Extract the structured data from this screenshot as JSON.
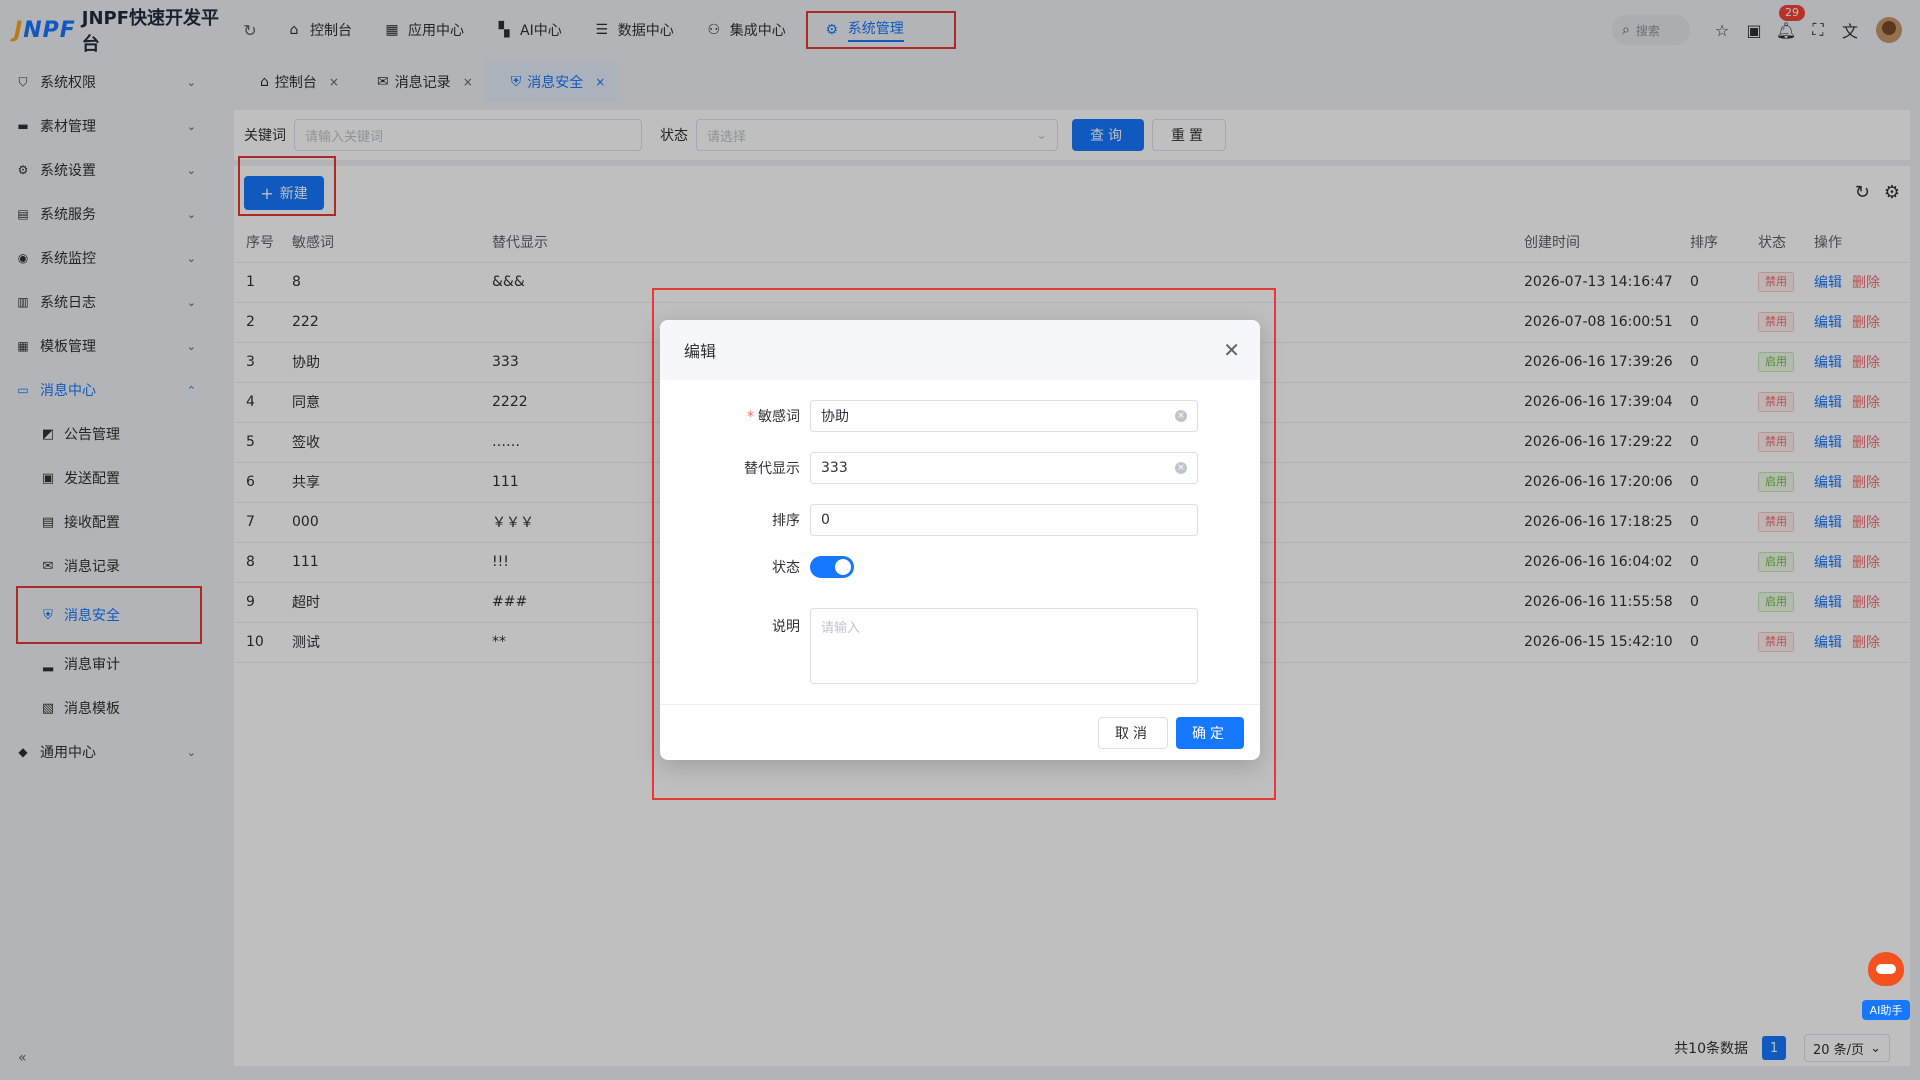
{
  "app": {
    "logo_mark_a": "J",
    "logo_mark_b": "N",
    "logo_mark_c": "PF",
    "title": "JNPF快速开发平台"
  },
  "topnav": [
    {
      "label": "控制台",
      "icon": "home-icon"
    },
    {
      "label": "应用中心",
      "icon": "grid-icon"
    },
    {
      "label": "AI中心",
      "icon": "ai-icon"
    },
    {
      "label": "数据中心",
      "icon": "database-icon"
    },
    {
      "label": "集成中心",
      "icon": "integration-icon"
    },
    {
      "label": "系统管理",
      "icon": "gear-icon",
      "active": true
    }
  ],
  "header_tools": {
    "search_placeholder": "搜索",
    "notification_count": "29"
  },
  "sidebar": {
    "items": [
      {
        "label": "系统权限"
      },
      {
        "label": "素材管理"
      },
      {
        "label": "系统设置"
      },
      {
        "label": "系统服务"
      },
      {
        "label": "系统监控"
      },
      {
        "label": "系统日志"
      },
      {
        "label": "模板管理"
      },
      {
        "label": "消息中心",
        "open": true
      },
      {
        "label": "通用中心"
      }
    ],
    "subitems": [
      {
        "label": "公告管理"
      },
      {
        "label": "发送配置"
      },
      {
        "label": "接收配置"
      },
      {
        "label": "消息记录"
      },
      {
        "label": "消息安全",
        "active": true
      },
      {
        "label": "消息审计"
      },
      {
        "label": "消息模板"
      }
    ]
  },
  "tabs": [
    {
      "label": "控制台"
    },
    {
      "label": "消息记录"
    },
    {
      "label": "消息安全",
      "active": true
    }
  ],
  "filter": {
    "keyword_label": "关键词",
    "keyword_placeholder": "请输入关键词",
    "status_label": "状态",
    "status_placeholder": "请选择",
    "query_label": "查询",
    "reset_label": "重置"
  },
  "toolbar": {
    "new_label": "新建"
  },
  "table": {
    "columns": [
      "序号",
      "敏感词",
      "替代显示",
      "创建时间",
      "排序",
      "状态",
      "操作"
    ],
    "rows": [
      {
        "no": "1",
        "word": "8",
        "replace": "&&&",
        "time": "2026-07-13 14:16:47",
        "sort": "0",
        "status": "禁用"
      },
      {
        "no": "2",
        "word": "222",
        "replace": "",
        "time": "2026-07-08 16:00:51",
        "sort": "0",
        "status": "禁用"
      },
      {
        "no": "3",
        "word": "协助",
        "replace": "333",
        "time": "2026-06-16 17:39:26",
        "sort": "0",
        "status": "启用"
      },
      {
        "no": "4",
        "word": "同意",
        "replace": "2222",
        "time": "2026-06-16 17:39:04",
        "sort": "0",
        "status": "禁用"
      },
      {
        "no": "5",
        "word": "签收",
        "replace": "……",
        "time": "2026-06-16 17:29:22",
        "sort": "0",
        "status": "禁用"
      },
      {
        "no": "6",
        "word": "共享",
        "replace": "111",
        "time": "2026-06-16 17:20:06",
        "sort": "0",
        "status": "启用"
      },
      {
        "no": "7",
        "word": "000",
        "replace": "￥￥￥",
        "time": "2026-06-16 17:18:25",
        "sort": "0",
        "status": "禁用"
      },
      {
        "no": "8",
        "word": "111",
        "replace": "!!!",
        "time": "2026-06-16 16:04:02",
        "sort": "0",
        "status": "启用"
      },
      {
        "no": "9",
        "word": "超时",
        "replace": "###",
        "time": "2026-06-16 11:55:58",
        "sort": "0",
        "status": "启用"
      },
      {
        "no": "10",
        "word": "测试",
        "replace": "**",
        "time": "2026-06-15 15:42:10",
        "sort": "0",
        "status": "禁用"
      }
    ],
    "edit_label": "编辑",
    "delete_label": "删除"
  },
  "pagination": {
    "total_text": "共10条数据",
    "current_page": "1",
    "page_size": "20 条/页"
  },
  "dialog": {
    "title": "编辑",
    "fields": {
      "word_label": "敏感词",
      "word_value": "协助",
      "replace_label": "替代显示",
      "replace_value": "333",
      "sort_label": "排序",
      "sort_value": "0",
      "status_label": "状态",
      "status_on": true,
      "desc_label": "说明",
      "desc_placeholder": "请输入"
    },
    "cancel_label": "取消",
    "ok_label": "确定"
  },
  "ai_helper": {
    "label": "AI助手"
  },
  "colors": {
    "accent": "#1677ff",
    "danger": "#f56c6c",
    "success": "#67c23a",
    "highlight": "#e53935"
  }
}
